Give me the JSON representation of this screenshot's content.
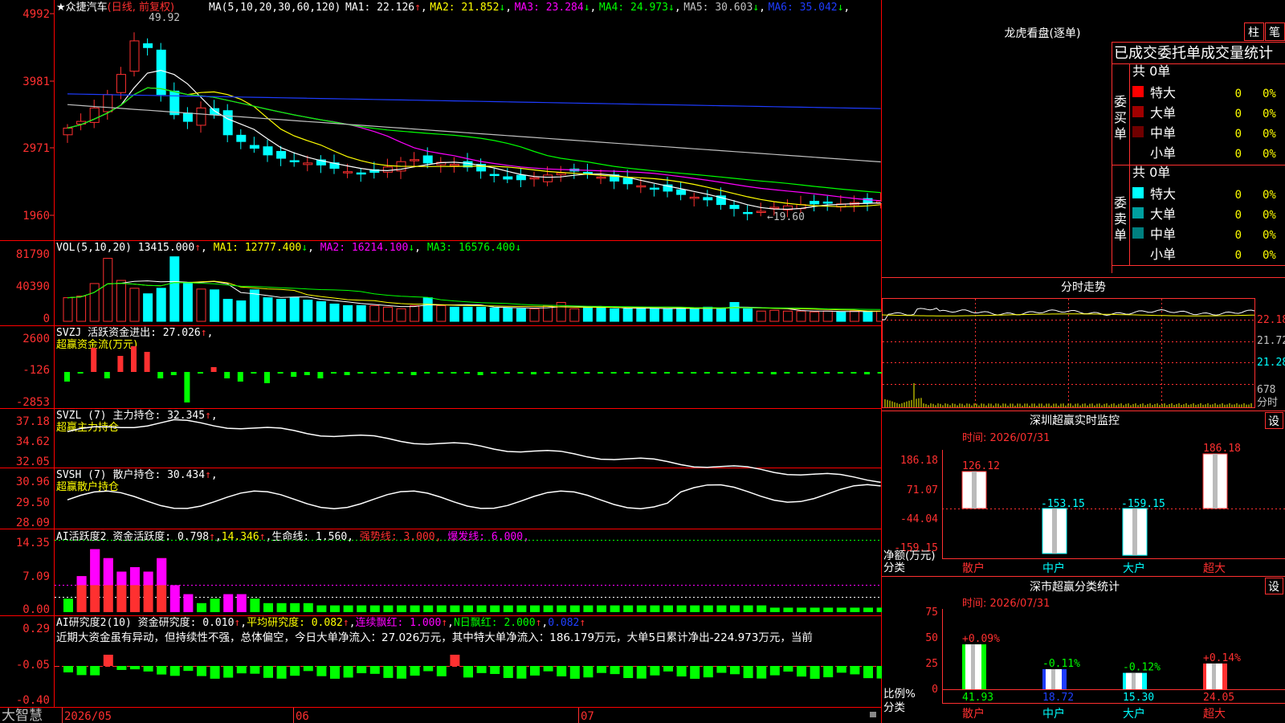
{
  "app": {
    "brand": "大智慧",
    "tab_zhu": "柱",
    "tab_bi": "笔"
  },
  "stock": {
    "name": "★众捷汽车",
    "period": "(日线, 前复权)",
    "high_label": "49.92",
    "low_label": "←19.60"
  },
  "main_axis": {
    "ticks": [
      "4992",
      "3981",
      "2971",
      "1960"
    ]
  },
  "ma_header": {
    "label": "MA(5,10,20,30,60,120)",
    "items": [
      {
        "k": "MA1:",
        "v": "22.126",
        "arrow": "↑",
        "color": "#ffffff"
      },
      {
        "k": "MA2:",
        "v": "21.852",
        "arrow": "↓",
        "color": "#ffff00"
      },
      {
        "k": "MA3:",
        "v": "23.284",
        "arrow": "↓",
        "color": "#ff00ff"
      },
      {
        "k": "MA4:",
        "v": "24.973",
        "arrow": "↓",
        "color": "#00ff00"
      },
      {
        "k": "MA5:",
        "v": "30.603",
        "arrow": "↓",
        "color": "#c0c0c0"
      },
      {
        "k": "MA6:",
        "v": "35.042",
        "arrow": "↓",
        "color": "#1e3cff"
      }
    ]
  },
  "vol": {
    "label": "VOL(5,10,20)",
    "value": "13415.000",
    "ma1": "MA1: 12777.400",
    "ma2": "MA2: 16214.100",
    "ma3": "MA3: 16576.400",
    "ticks": [
      "81790",
      "40390",
      "0"
    ]
  },
  "svzj": {
    "label": "SVZJ  活跃资金进出: 27.026",
    "sub": "超赢资金流(万元)",
    "ticks": [
      "2600",
      "-126",
      "-2853"
    ]
  },
  "svzl": {
    "label": "SVZL (7) 主力持仓: 32.345",
    "sub": "超赢主力持仓",
    "ticks": [
      "37.18",
      "34.62",
      "32.05"
    ]
  },
  "svsh": {
    "label": "SVSH (7) 散户持仓: 30.434",
    "sub": "超赢散户持仓",
    "ticks": [
      "30.96",
      "29.50",
      "28.09"
    ]
  },
  "ai1": {
    "l1": "AI活跃度2 资金活跃度: 0.798",
    "l2": "14.346",
    "l3": "生命线: 1.560",
    "l4": "强势线: 3.000",
    "l5": "爆发线: 6.000",
    "ticks": [
      "14.35",
      "7.09",
      "0.00"
    ]
  },
  "ai2": {
    "l1": "AI研究度2(10) 资金研究度: 0.010",
    "l2": "平均研究度: 0.082",
    "l3": "连续飘红: 1.000",
    "l4": "N日飘红: 2.000",
    "l5": "0.082",
    "text": "近期大资金虽有异动，但持续性不强，总体偏空，今日大单净流入：27.026万元，其中特大单净流入：186.179万元，大单5日累计净出-224.973万元，当前",
    "ticks": [
      "0.29",
      "-0.05",
      "-0.40"
    ]
  },
  "xaxis": {
    "labels": [
      "2026/05",
      "06",
      "07"
    ]
  },
  "lhb": {
    "title": "龙虎看盘(逐单)",
    "header": "已成交委托单成交量统计",
    "buy": {
      "side": "委买单",
      "total": "共 0单",
      "rows": [
        {
          "n": "特大",
          "c": "#ff0000",
          "v": "0",
          "p": "0%"
        },
        {
          "n": "大单",
          "c": "#a00000",
          "v": "0",
          "p": "0%"
        },
        {
          "n": "中单",
          "c": "#700000",
          "v": "0",
          "p": "0%"
        },
        {
          "n": "小单",
          "c": "",
          "v": "0",
          "p": "0%"
        }
      ]
    },
    "sell": {
      "side": "委卖单",
      "total": "共 0单",
      "rows": [
        {
          "n": "特大",
          "c": "#00ffff",
          "v": "0",
          "p": "0%"
        },
        {
          "n": "大单",
          "c": "#00a0a0",
          "v": "0",
          "p": "0%"
        },
        {
          "n": "中单",
          "c": "#008080",
          "v": "0",
          "p": "0%"
        },
        {
          "n": "小单",
          "c": "",
          "v": "0",
          "p": "0%"
        }
      ]
    }
  },
  "fenshi": {
    "title": "分时走势",
    "ticks": [
      "22.18",
      "21.72",
      "21.28"
    ],
    "vol_tick": "678",
    "vol_label": "分时"
  },
  "sz_monitor": {
    "title": "深圳超赢实时监控",
    "settings": "设",
    "time": "时间: 2026/07/31",
    "ticks": [
      "186.18",
      "71.07",
      "-44.04",
      "-159.15"
    ],
    "ylabel": "净额(万元)",
    "xlabel": "分类"
  },
  "sh_stats": {
    "title": "深市超赢分类统计",
    "settings": "设",
    "time": "时间: 2026/07/31",
    "ticks": [
      "75",
      "50",
      "25",
      "0"
    ],
    "ylabel": "比例%",
    "xlabel": "分类"
  },
  "chart_data": [
    {
      "type": "line",
      "title": "★众捷汽车 (日线, 前复权)",
      "x": [
        "2026/05",
        "06",
        "07"
      ],
      "y_ticks": [
        4992,
        3981,
        2971,
        1960
      ],
      "series": [
        {
          "name": "MA1",
          "values": [
            22.126
          ]
        },
        {
          "name": "MA2",
          "values": [
            21.852
          ]
        },
        {
          "name": "MA3",
          "values": [
            23.284
          ]
        },
        {
          "name": "MA4",
          "values": [
            24.973
          ]
        },
        {
          "name": "MA5",
          "values": [
            30.603
          ]
        },
        {
          "name": "MA6",
          "values": [
            35.042
          ]
        }
      ],
      "annotations": [
        "49.92",
        "←19.60"
      ]
    },
    {
      "type": "bar",
      "title": "深圳超赢实时监控",
      "categories": [
        "散户",
        "中户",
        "大户",
        "超大"
      ],
      "values": [
        126.12,
        -153.15,
        -159.15,
        186.18
      ],
      "ylim": [
        -159.15,
        186.18
      ],
      "ylabel": "净额(万元)",
      "xlabel": "分类"
    },
    {
      "type": "bar",
      "title": "深市超赢分类统计",
      "categories": [
        "散户",
        "中户",
        "大户",
        "超大"
      ],
      "values": [
        41.93,
        18.72,
        15.3,
        24.05
      ],
      "changes": [
        "+0.09%",
        "-0.11%",
        "-0.12%",
        "+0.14%"
      ],
      "ylim": [
        0,
        75
      ],
      "ylabel": "比例%",
      "xlabel": "分类"
    }
  ]
}
